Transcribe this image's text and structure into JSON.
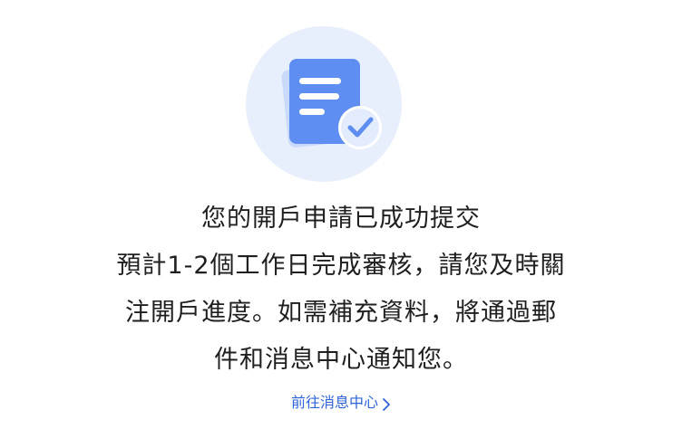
{
  "status": {
    "title": "您的開戶申請已成功提交",
    "lines": [
      "預計1-2個工作日完成審核，請您及時關",
      "注開戶進度。如需補充資料，將通過郵",
      "件和消息中心通知您。"
    ]
  },
  "actions": {
    "message_center_link": "前往消息中心"
  },
  "icons": {
    "illustration": "document-check-icon",
    "chevron": "chevron-right-icon"
  },
  "colors": {
    "illustration_circle": "#e8effc",
    "document_primary": "#5f8ef2",
    "document_back": "#c9dafc",
    "link": "#2f64d9",
    "text": "#1f1f1f"
  }
}
